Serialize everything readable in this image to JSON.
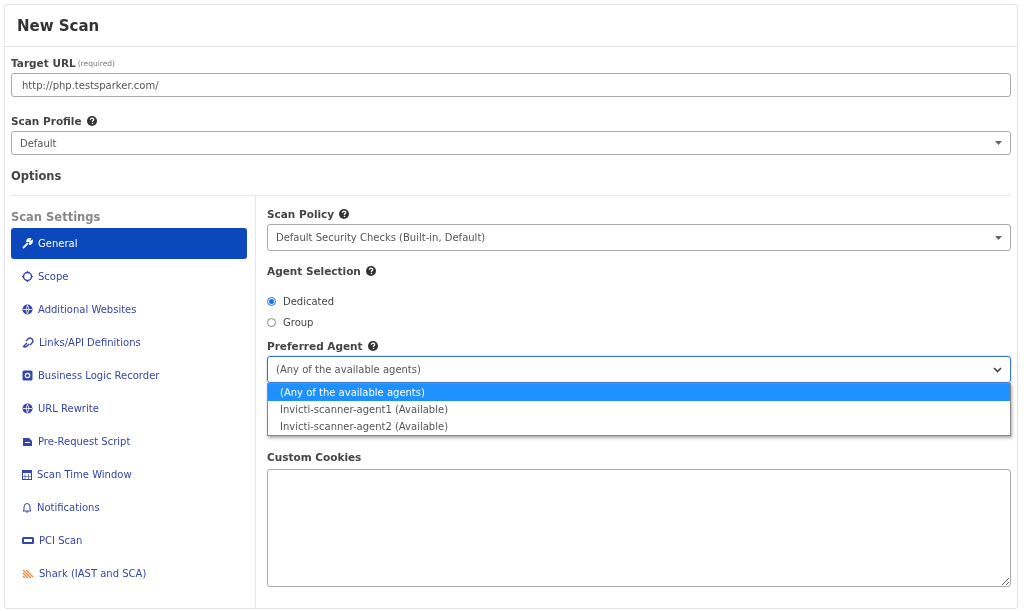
{
  "page": {
    "title": "New Scan"
  },
  "target_url": {
    "label": "Target URL",
    "hint": "(required)",
    "value": "http://php.testsparker.com/"
  },
  "scan_profile": {
    "label": "Scan Profile",
    "value": "Default"
  },
  "options": {
    "title": "Options"
  },
  "sidebar": {
    "title": "Scan Settings",
    "items": [
      {
        "label": "General",
        "selected": true
      },
      {
        "label": "Scope",
        "selected": false
      },
      {
        "label": "Additional Websites",
        "selected": false
      },
      {
        "label": "Links/API Definitions",
        "selected": false
      },
      {
        "label": "Business Logic Recorder",
        "selected": false
      },
      {
        "label": "URL Rewrite",
        "selected": false
      },
      {
        "label": "Pre-Request Script",
        "selected": false
      },
      {
        "label": "Scan Time Window",
        "selected": false
      },
      {
        "label": "Notifications",
        "selected": false
      },
      {
        "label": "PCI Scan",
        "selected": false
      },
      {
        "label": "Shark (IAST and SCA)",
        "selected": false
      }
    ]
  },
  "scan_policy": {
    "label": "Scan Policy",
    "value": "Default Security Checks (Built-in, Default)"
  },
  "agent_selection": {
    "label": "Agent Selection",
    "options": [
      {
        "label": "Dedicated",
        "selected": true
      },
      {
        "label": "Group",
        "selected": false
      }
    ]
  },
  "preferred_agent": {
    "label": "Preferred Agent",
    "value": "(Any of the available agents)",
    "expanded": true,
    "options": [
      {
        "label": "(Any of the available agents)",
        "selected": true
      },
      {
        "label": "Invicti-scanner-agent1 (Available)",
        "selected": false
      },
      {
        "label": "Invicti-scanner-agent2 (Available)",
        "selected": false
      }
    ]
  },
  "custom_cookies": {
    "label": "Custom Cookies"
  }
}
